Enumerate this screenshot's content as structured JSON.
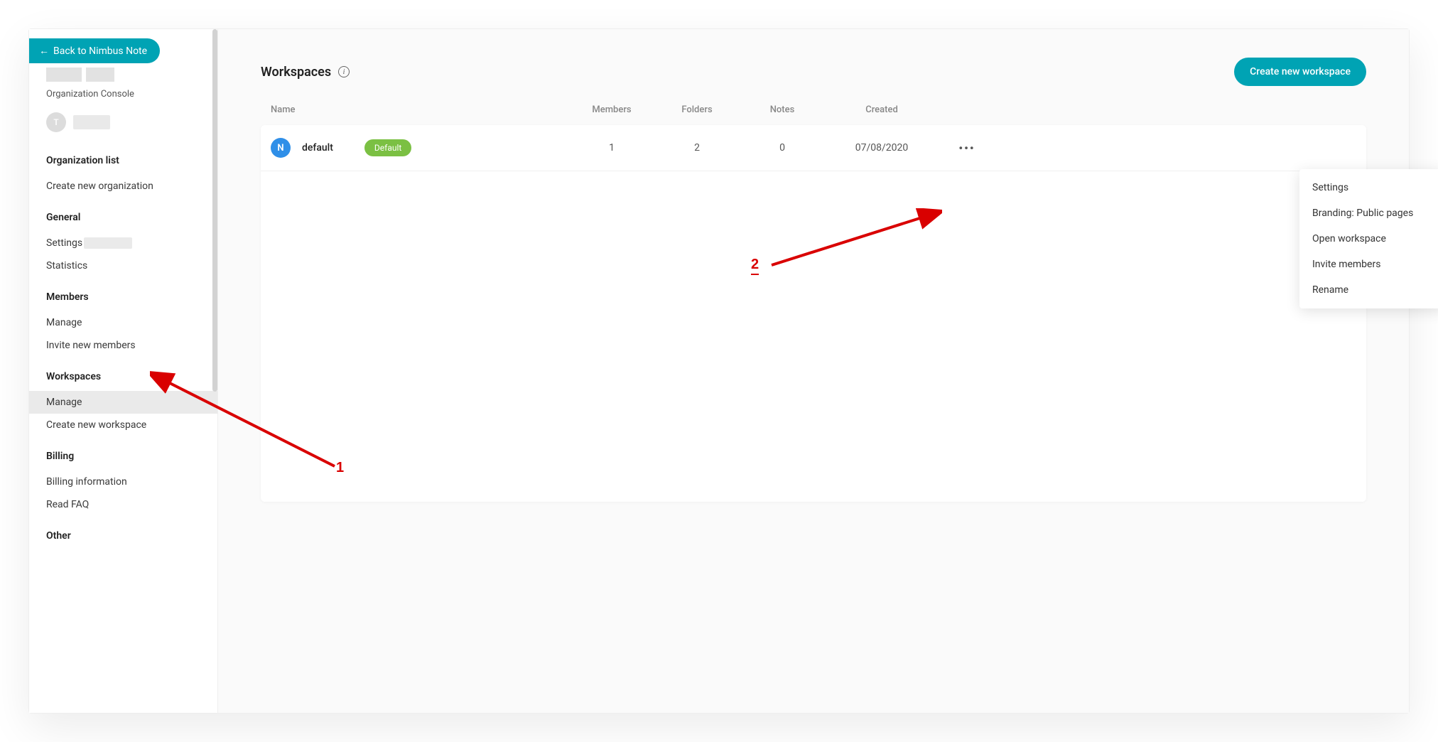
{
  "back_button": {
    "label": "Back to Nimbus Note"
  },
  "org": {
    "console_label": "Organization Console"
  },
  "user": {
    "avatar_letter": "T"
  },
  "sidebar": {
    "sections": [
      {
        "heading": "Organization list",
        "items": [
          {
            "label": "Create new organization"
          }
        ]
      },
      {
        "heading": "General",
        "items": [
          {
            "label": "Settings"
          },
          {
            "label": "Statistics"
          }
        ]
      },
      {
        "heading": "Members",
        "items": [
          {
            "label": "Manage"
          },
          {
            "label": "Invite new members"
          }
        ]
      },
      {
        "heading": "Workspaces",
        "items": [
          {
            "label": "Manage"
          },
          {
            "label": "Create new workspace"
          }
        ]
      },
      {
        "heading": "Billing",
        "items": [
          {
            "label": "Billing information"
          },
          {
            "label": "Read FAQ"
          }
        ]
      },
      {
        "heading": "Other",
        "items": []
      }
    ]
  },
  "main": {
    "title": "Workspaces",
    "create_button": "Create new workspace",
    "columns": {
      "name": "Name",
      "members": "Members",
      "folders": "Folders",
      "notes": "Notes",
      "created": "Created"
    },
    "rows": [
      {
        "icon_letter": "N",
        "name": "default",
        "badge": "Default",
        "members": "1",
        "folders": "2",
        "notes": "0",
        "created": "07/08/2020"
      }
    ],
    "context_menu": [
      "Settings",
      "Branding: Public pages",
      "Open workspace",
      "Invite members",
      "Rename"
    ]
  },
  "annotations": {
    "label1": "1",
    "label2": "2"
  }
}
